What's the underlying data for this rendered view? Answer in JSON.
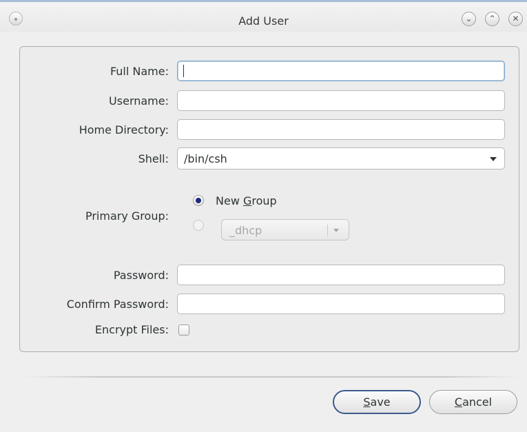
{
  "window": {
    "title": "Add User",
    "controls": [
      "minimize",
      "maximize",
      "close"
    ]
  },
  "form": {
    "full_name": {
      "label": "Full Name:",
      "value": ""
    },
    "username": {
      "label": "Username:",
      "value": ""
    },
    "home_directory": {
      "label": "Home Directory:",
      "value": ""
    },
    "shell": {
      "label": "Shell:",
      "value": "/bin/csh"
    },
    "primary_group": {
      "label": "Primary Group:",
      "new_group_prefix": "New ",
      "new_group_mnemonic": "G",
      "new_group_suffix": "roup",
      "selected": "new_group",
      "existing_group_value": "_dhcp"
    },
    "password": {
      "label": "Password:",
      "value": ""
    },
    "confirm_password": {
      "label": "Confirm Password:",
      "value": ""
    },
    "encrypt_files": {
      "label": "Encrypt Files:",
      "checked": false
    }
  },
  "buttons": {
    "save": {
      "mnemonic": "S",
      "rest": "ave"
    },
    "cancel": {
      "mnemonic": "C",
      "rest": "ancel"
    }
  },
  "colors": {
    "title_accent": "#a9bed6",
    "radio_selected": "#1c2a7a",
    "default_button_border": "#3a5a8c"
  }
}
